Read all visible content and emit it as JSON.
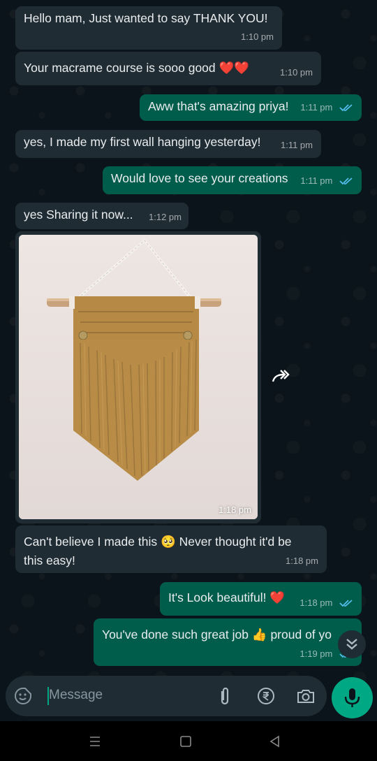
{
  "messages": [
    {
      "id": "m1",
      "dir": "in",
      "text": "Hello mam, Just wanted to say THANK YOU!",
      "time": "1:10 pm"
    },
    {
      "id": "m2",
      "dir": "in",
      "text": "Your macrame course is sooo good ❤️❤️",
      "time": "1:10 pm"
    },
    {
      "id": "m3",
      "dir": "out",
      "text": "Aww that's amazing priya!",
      "time": "1:11 pm"
    },
    {
      "id": "m4",
      "dir": "in",
      "text": "yes, I made my first wall hanging yesterday!",
      "time": "1:11 pm"
    },
    {
      "id": "m5",
      "dir": "out",
      "text": "Would love to see your creations",
      "time": "1:11 pm"
    },
    {
      "id": "m6",
      "dir": "in",
      "text": "yes Sharing it now...",
      "time": "1:12 pm"
    },
    {
      "id": "m7",
      "dir": "in",
      "type": "image",
      "image_desc": "macrame-wall-hanging",
      "time": "1:18 pm"
    },
    {
      "id": "m8",
      "dir": "in",
      "text": "Can't believe I made this 🥺 Never thought it'd be this easy!",
      "time": "1:18 pm"
    },
    {
      "id": "m9",
      "dir": "out",
      "text": "It's Look beautiful! ❤️",
      "time": "1:18 pm"
    },
    {
      "id": "m10",
      "dir": "out",
      "text": "You've done such great job 👍 proud of yo",
      "time": "1:19 pm"
    }
  ],
  "composer": {
    "placeholder": "Message"
  },
  "icons": {
    "emoji": "sticker-icon",
    "attach": "paperclip-icon",
    "payment": "rupee-icon",
    "camera": "camera-icon",
    "mic": "mic-icon",
    "forward": "forward-icon",
    "scroll_down": "double-chevron-down-icon"
  },
  "colors": {
    "incoming": "#202c33",
    "outgoing": "#005c4b",
    "accent": "#00a884",
    "read_tick": "#53bdeb",
    "background": "#0b141a"
  }
}
